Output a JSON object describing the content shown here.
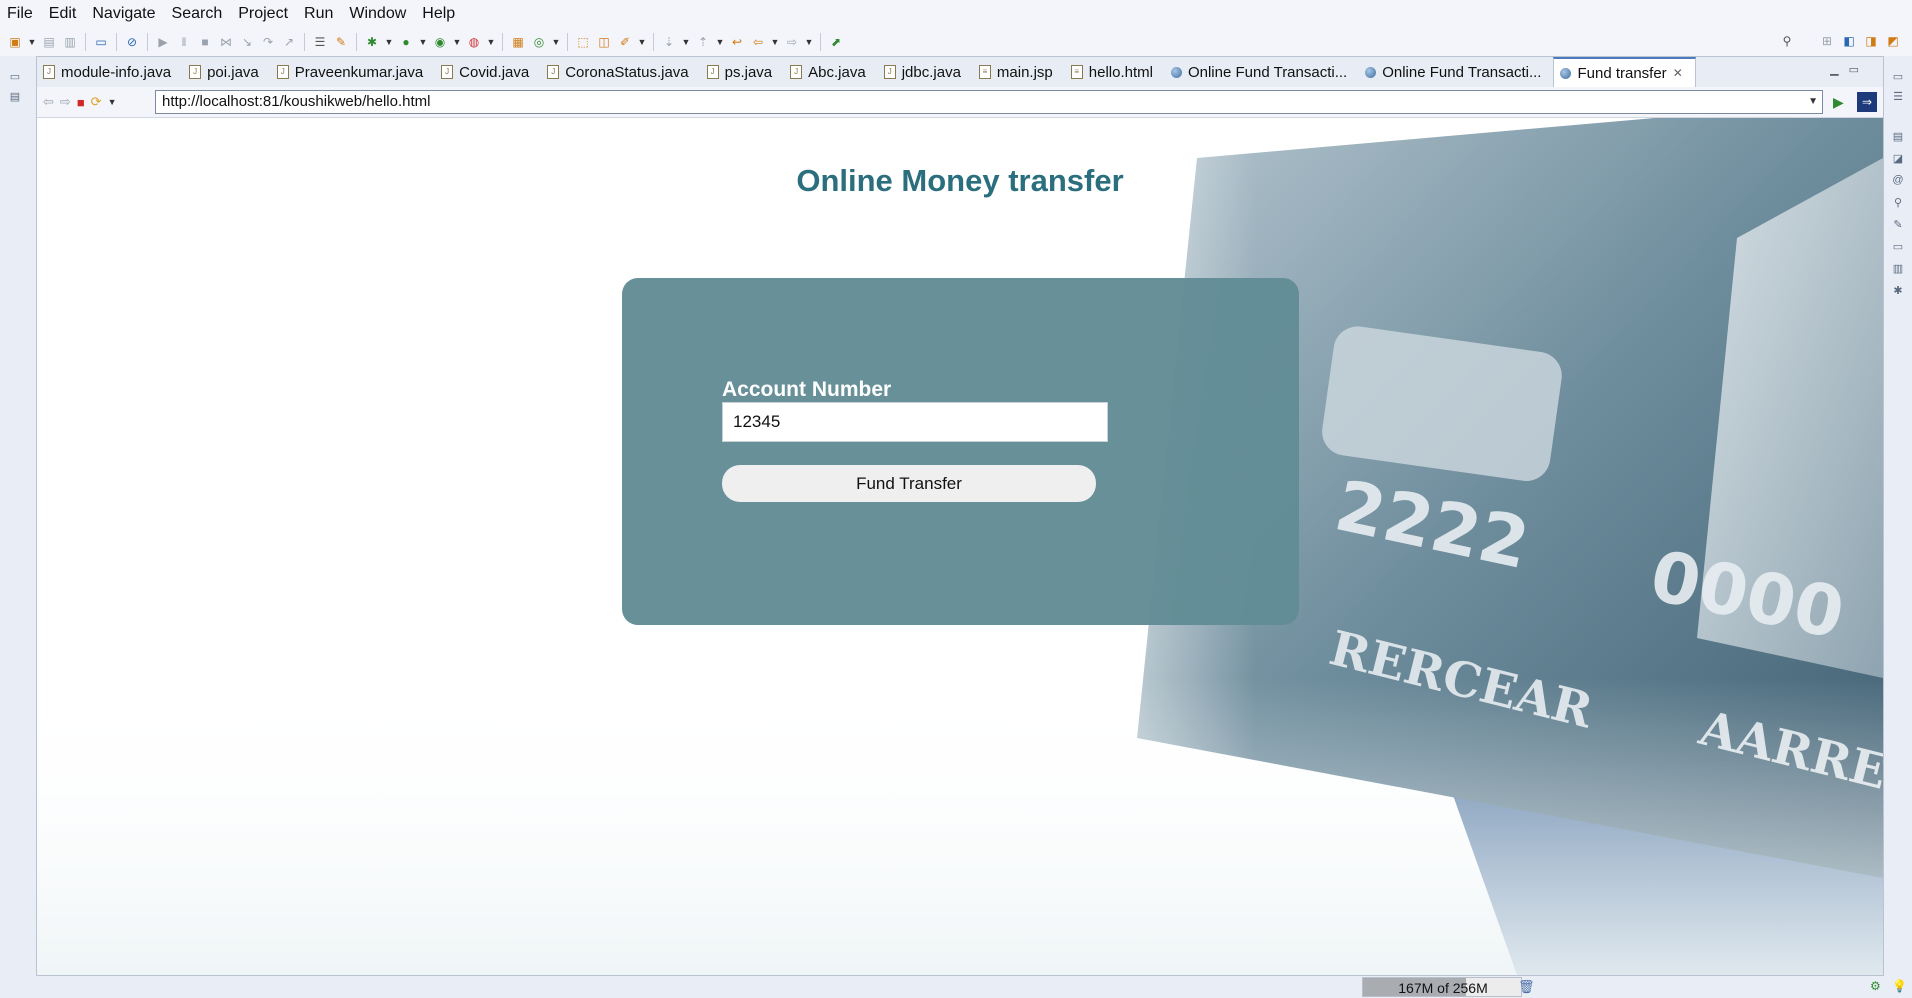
{
  "menu": [
    {
      "label": "File"
    },
    {
      "label": "Edit"
    },
    {
      "label": "Navigate"
    },
    {
      "label": "Search"
    },
    {
      "label": "Project"
    },
    {
      "label": "Run"
    },
    {
      "label": "Window"
    },
    {
      "label": "Help"
    }
  ],
  "tabs": [
    {
      "label": "module-info.java",
      "kind": "java"
    },
    {
      "label": "poi.java",
      "kind": "java"
    },
    {
      "label": "Praveenkumar.java",
      "kind": "java"
    },
    {
      "label": "Covid.java",
      "kind": "java"
    },
    {
      "label": "CoronaStatus.java",
      "kind": "java"
    },
    {
      "label": "ps.java",
      "kind": "java"
    },
    {
      "label": "Abc.java",
      "kind": "java"
    },
    {
      "label": "jdbc.java",
      "kind": "java"
    },
    {
      "label": "main.jsp",
      "kind": "file"
    },
    {
      "label": "hello.html",
      "kind": "file"
    },
    {
      "label": "Online Fund Transacti...",
      "kind": "web"
    },
    {
      "label": "Online Fund Transacti...",
      "kind": "web"
    },
    {
      "label": "Fund transfer",
      "kind": "web",
      "active": true
    }
  ],
  "browser": {
    "url": "http://localhost:81/koushikweb/hello.html"
  },
  "page": {
    "title": "Online Money transfer",
    "account_label": "Account Number",
    "account_value": "12345",
    "submit_label": "Fund Transfer"
  },
  "status": {
    "heap": "167M of 256M",
    "heap_used_fraction": 0.652
  },
  "colors": {
    "title": "#2b6f7f",
    "panel": "#628c96",
    "tab_accent": "#4b7bbd"
  }
}
